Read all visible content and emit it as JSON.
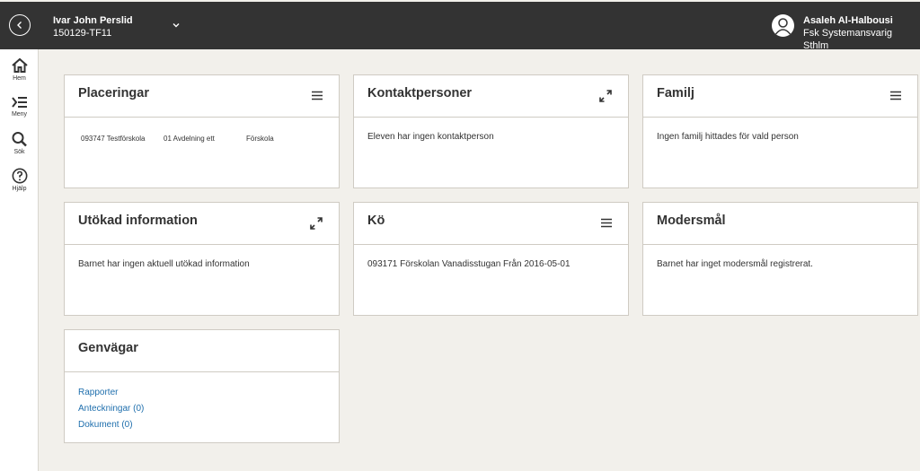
{
  "header": {
    "student_name": "Ivar John Perslid",
    "student_id": "150129-TF11",
    "user_name": "Asaleh Al-Halbousi",
    "user_role": "Fsk Systemansvarig Sthlm"
  },
  "sidebar": {
    "items": [
      {
        "label": "Hem",
        "icon": "home-icon"
      },
      {
        "label": "Meny",
        "icon": "menu-icon"
      },
      {
        "label": "Sök",
        "icon": "search-icon"
      },
      {
        "label": "Hjälp",
        "icon": "help-icon"
      }
    ]
  },
  "cards": {
    "placeringar": {
      "title": "Placeringar",
      "row": [
        "093747 Testförskola",
        "01 Avdelning ett",
        "Förskola"
      ]
    },
    "kontaktpersoner": {
      "title": "Kontaktpersoner",
      "text": "Eleven har ingen kontaktperson"
    },
    "familj": {
      "title": "Familj",
      "text": "Ingen familj hittades för vald person"
    },
    "utokad": {
      "title": "Utökad information",
      "text": "Barnet har ingen aktuell utökad information"
    },
    "ko": {
      "title": "Kö",
      "text": "093171 Förskolan Vanadisstugan Från 2016-05-01"
    },
    "modersmal": {
      "title": "Modersmål",
      "text": "Barnet har inget modersmål registrerat."
    },
    "genvagar": {
      "title": "Genvägar",
      "links": [
        "Rapporter",
        "Anteckningar (0)",
        "Dokument (0)"
      ]
    }
  },
  "colors": {
    "topbar": "#333333",
    "background": "#f2f0eb",
    "link": "#1f6fad"
  }
}
